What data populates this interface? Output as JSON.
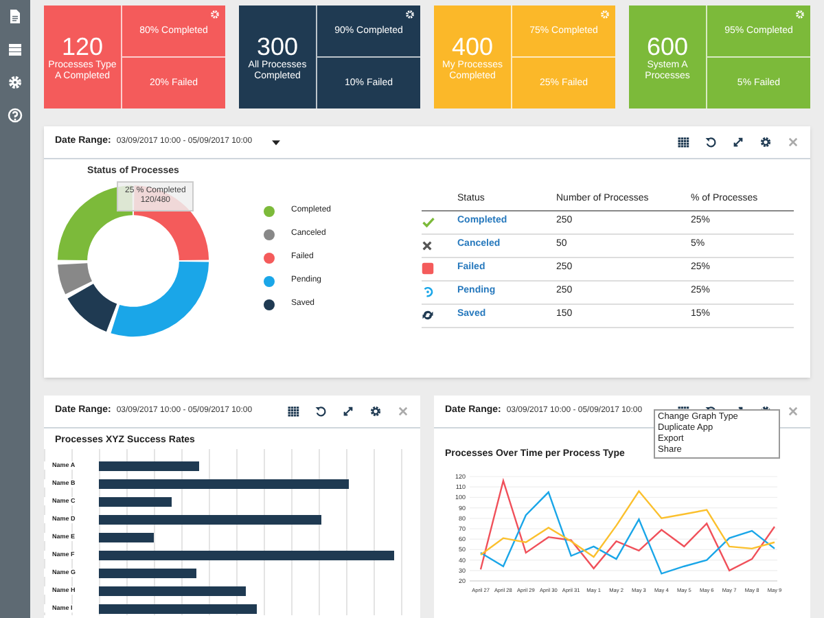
{
  "summary_cards": [
    {
      "total": "120",
      "label": "Processes Type A Completed",
      "top": "80% Completed",
      "bottom": "20% Failed",
      "color": "#f45b5b"
    },
    {
      "total": "300",
      "label": "All Processes Completed",
      "top": "90% Completed",
      "bottom": "10% Failed",
      "color": "#1f3a52"
    },
    {
      "total": "400",
      "label": "My Processes Completed",
      "top": "75% Completed",
      "bottom": "25% Failed",
      "color": "#fbb829"
    },
    {
      "total": "600",
      "label": "System A Processes",
      "top": "95% Completed",
      "bottom": "5% Failed",
      "color": "#7cba3a"
    }
  ],
  "status_panel": {
    "date_label": "Date Range:",
    "date_value": "03/09/2017 10:00 - 05/09/2017 10:00",
    "donut_title": "Status of Processes",
    "tooltip": [
      "25 % Completed",
      "120/480"
    ],
    "legend": [
      {
        "label": "Completed",
        "color": "#7cba3a"
      },
      {
        "label": "Canceled",
        "color": "#888888"
      },
      {
        "label": "Failed",
        "color": "#f45b5b"
      },
      {
        "label": "Pending",
        "color": "#1aa6e8"
      },
      {
        "label": "Saved",
        "color": "#1f3a52"
      }
    ],
    "columns": [
      "Status",
      "Number of Processes",
      "% of Processes"
    ],
    "rows": [
      {
        "kind": "completed",
        "status": "Completed",
        "count": "250",
        "percent": "25%"
      },
      {
        "kind": "canceled",
        "status": "Canceled",
        "count": "50",
        "percent": "5%"
      },
      {
        "kind": "failed",
        "status": "Failed",
        "count": "250",
        "percent": "25%"
      },
      {
        "kind": "pending",
        "status": "Pending",
        "count": "250",
        "percent": "25%"
      },
      {
        "kind": "saved",
        "status": "Saved",
        "count": "150",
        "percent": "15%"
      }
    ]
  },
  "bar_panel": {
    "date_label": "Date Range:",
    "date_value": "03/09/2017 10:00 - 05/09/2017 10:00",
    "title": "Processes XYZ Success Rates",
    "names": [
      "Name A",
      "Name B",
      "Name C",
      "Name D",
      "Name E",
      "Name F",
      "Name G",
      "Name H",
      "Name I"
    ]
  },
  "line_panel": {
    "date_label": "Date Range:",
    "date_value": "03/09/2017 10:00 - 05/09/2017 10:00",
    "menu": [
      "Change Graph Type",
      "Duplicate App",
      "Export",
      "Share"
    ],
    "chart_data": {
      "type": "line",
      "title": "Processes Over Time per Process Type",
      "categories": [
        "April 27",
        "April 28",
        "April 29",
        "April 30",
        "April 31",
        "May 1",
        "May 2",
        "May 3",
        "May 4",
        "May 5",
        "May 6",
        "May 7",
        "May 8",
        "May 9"
      ],
      "ylim": [
        20,
        120
      ],
      "yticks": [
        20,
        30,
        40,
        50,
        60,
        70,
        80,
        90,
        100,
        110,
        120
      ],
      "grid": true,
      "series": [
        {
          "color": "#f0505a",
          "values": [
            31,
            116,
            47,
            62,
            59,
            32,
            58,
            49,
            69,
            53,
            75,
            30,
            41,
            72
          ]
        },
        {
          "color": "#1aa6e8",
          "values": [
            47,
            34,
            83,
            105,
            44,
            53,
            41,
            79,
            27,
            34,
            40,
            61,
            68,
            51
          ]
        },
        {
          "color": "#fbc02d",
          "values": [
            45,
            61,
            57,
            71,
            58,
            43,
            73,
            106,
            80,
            84,
            88,
            53,
            51,
            57
          ]
        }
      ]
    }
  }
}
